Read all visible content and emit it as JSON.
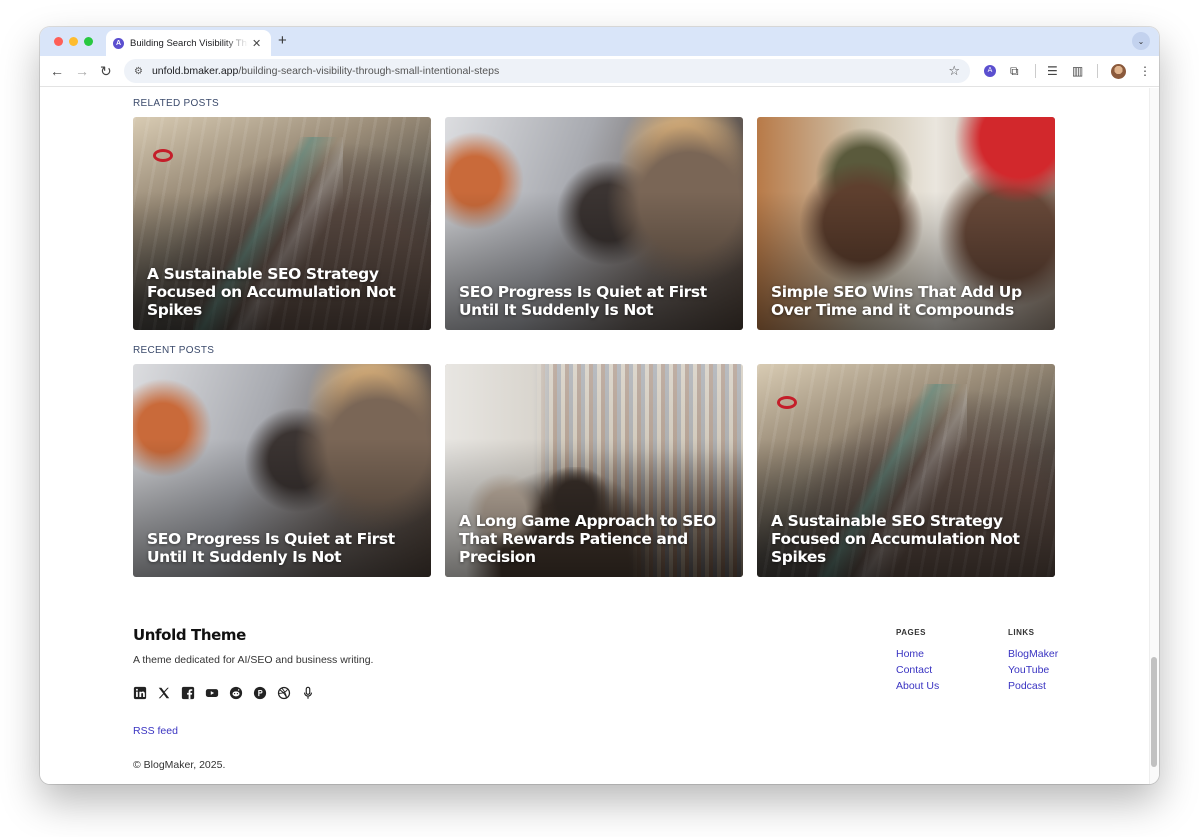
{
  "browser": {
    "tab_title": "Building Search Visibility Through Small Intentional Steps",
    "tab_favicon": "A",
    "url_domain": "unfold.bmaker.app",
    "url_path": "/building-search-visibility-through-small-intentional-steps",
    "ext_badge": "A"
  },
  "related": {
    "label": "RELATED POSTS",
    "posts": [
      {
        "title": "A Sustainable SEO Strategy Focused on Accumulation Not Spikes",
        "image": "station"
      },
      {
        "title": "SEO Progress Is Quiet at First Until It Suddenly Is Not",
        "image": "friends"
      },
      {
        "title": "Simple SEO Wins That Add Up Over Time and it Compounds",
        "image": "veteran"
      }
    ]
  },
  "recent": {
    "label": "RECENT POSTS",
    "posts": [
      {
        "title": "SEO Progress Is Quiet at First Until It Suddenly Is Not",
        "image": "friends"
      },
      {
        "title": "A Long Game Approach to SEO That Rewards Patience and Precision",
        "image": "library"
      },
      {
        "title": "A Sustainable SEO Strategy Focused on Accumulation Not Spikes",
        "image": "station"
      }
    ]
  },
  "footer": {
    "brand": "Unfold Theme",
    "tagline": "A theme dedicated for AI/SEO and business writing.",
    "social_icons": [
      "linkedin-icon",
      "x-icon",
      "facebook-icon",
      "youtube-icon",
      "reddit-icon",
      "producthunt-icon",
      "dribbble-icon",
      "microphone-icon"
    ],
    "rss": "RSS feed",
    "copyright": "© BlogMaker, 2025.",
    "pages": {
      "heading": "PAGES",
      "links": [
        "Home",
        "Contact",
        "About Us"
      ]
    },
    "links": {
      "heading": "LINKS",
      "links": [
        "BlogMaker",
        "YouTube",
        "Podcast"
      ]
    }
  },
  "colors": {
    "link": "#3a34c2",
    "tabbar": "#d9e5f9",
    "label": "#3b4a6b"
  }
}
